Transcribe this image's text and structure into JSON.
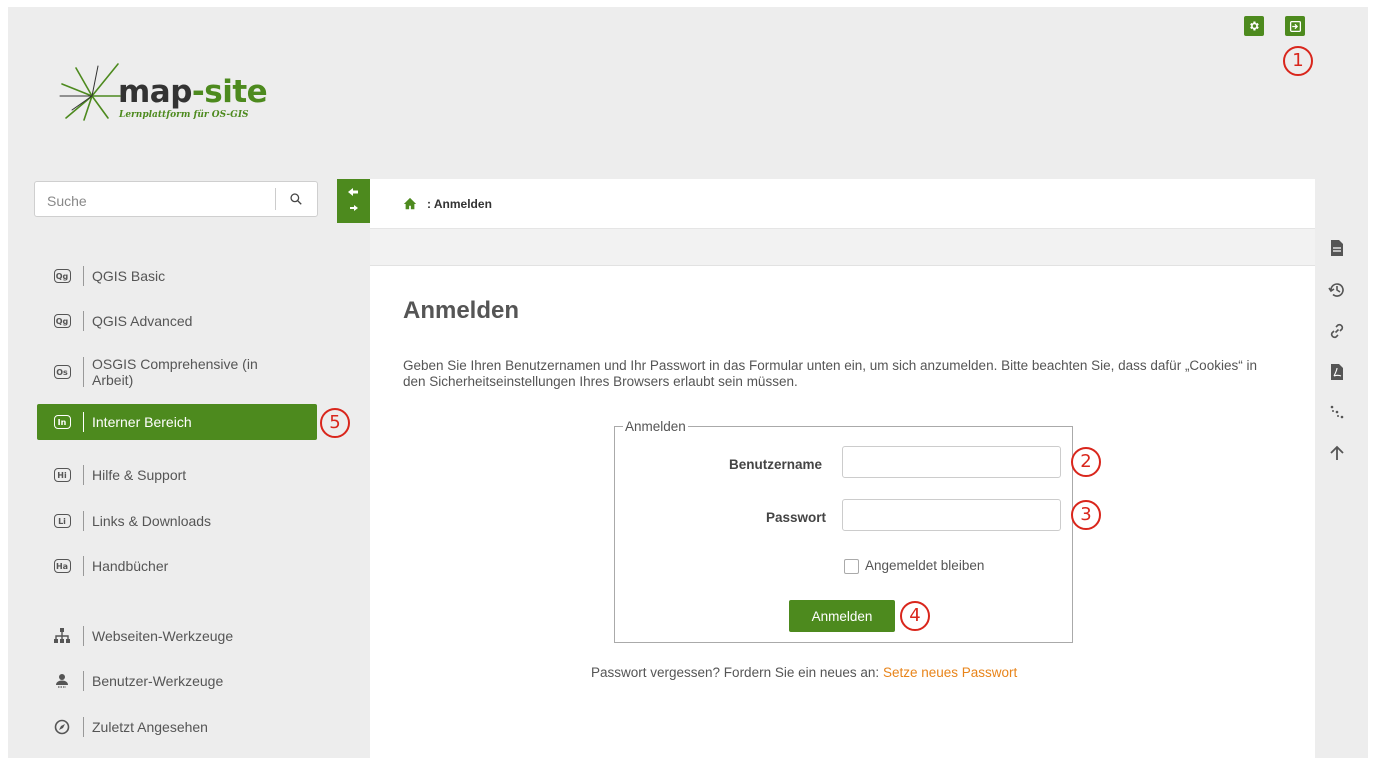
{
  "logo": {
    "brand_part1": "map",
    "brand_part2": "-site",
    "tagline": "Lernplattform für OS-GIS"
  },
  "top_actions": {
    "settings_icon": "gear-icon",
    "login_icon": "login-icon"
  },
  "search": {
    "placeholder": "Suche",
    "icon": "search-icon"
  },
  "sidebar": {
    "items": [
      {
        "badge": "Qg",
        "label": "QGIS Basic"
      },
      {
        "badge": "Qg",
        "label": "QGIS Advanced"
      },
      {
        "badge": "Os",
        "label": "OSGIS Comprehensive (in Arbeit)"
      },
      {
        "badge": "In",
        "label": "Interner Bereich",
        "active": true
      },
      {
        "badge": "Hi",
        "label": "Hilfe & Support"
      },
      {
        "badge": "Li",
        "label": "Links & Downloads"
      },
      {
        "badge": "Ha",
        "label": "Handbücher"
      }
    ],
    "tools": [
      {
        "icon": "sitemap-icon",
        "label": "Webseiten-Werkzeuge"
      },
      {
        "icon": "user-icon",
        "label": "Benutzer-Werkzeuge"
      },
      {
        "icon": "compass-icon",
        "label": "Zuletzt Angesehen"
      }
    ]
  },
  "breadcrumb": {
    "text": ": Anmelden"
  },
  "main": {
    "title": "Anmelden",
    "intro": "Geben Sie Ihren Benutzernamen und Ihr Passwort in das Formular unten ein, um sich anzumelden. Bitte beachten Sie, dass dafür „Cookies“ in den Sicherheitseinstellungen Ihres Browsers erlaubt sein müssen.",
    "form": {
      "legend": "Anmelden",
      "username_label": "Benutzername",
      "username_value": "",
      "password_label": "Passwort",
      "password_value": "",
      "remember_label": "Angemeldet bleiben",
      "remember_checked": false,
      "submit_label": "Anmelden"
    },
    "forgot": {
      "text": "Passwort vergessen? Fordern Sie ein neues an:",
      "link": "Setze neues Passwort"
    }
  },
  "markers": [
    "1",
    "2",
    "3",
    "4",
    "5"
  ],
  "right_toolbar": [
    "page-icon",
    "history-icon",
    "link-icon",
    "pdf-icon",
    "sitemap-dots-icon",
    "arrow-up-icon"
  ],
  "colors": {
    "accent": "#4d8a1e",
    "marker": "#d9261c",
    "link": "#e8841a"
  }
}
